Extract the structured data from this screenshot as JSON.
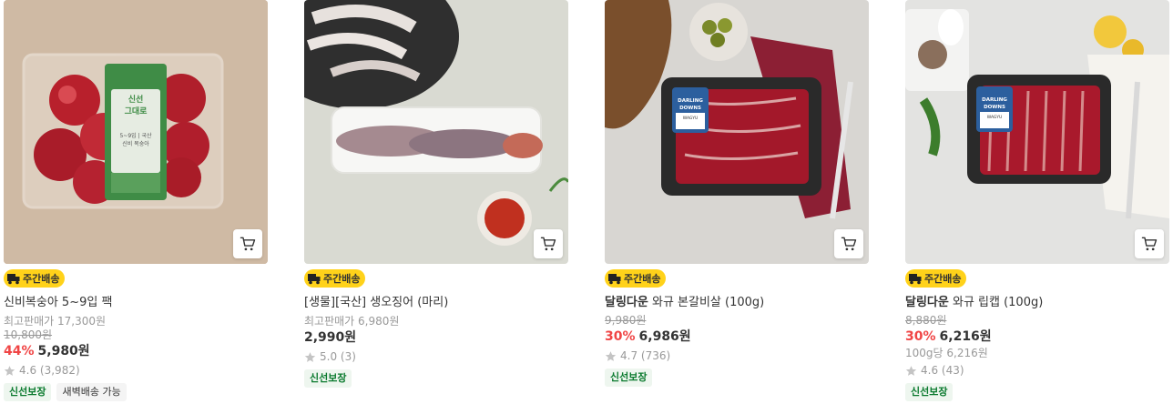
{
  "products": [
    {
      "weekly_badge": "주간배송",
      "brand": "",
      "name": "신비복숭아 5~9입 팩",
      "lowest_price": "최고판매가 17,300원",
      "original_price": "10,800원",
      "discount": "44%",
      "price": "5,980원",
      "unit_price": "",
      "rating": "4.6",
      "reviews": "(3,982)",
      "tags": [
        "신선보장",
        "새벽배송 가능"
      ]
    },
    {
      "weekly_badge": "주간배송",
      "brand": "",
      "name": "[생물][국산] 생오징어 (마리)",
      "lowest_price": "최고판매가 6,980원",
      "original_price": "",
      "discount": "",
      "price": "2,990원",
      "unit_price": "",
      "rating": "5.0",
      "reviews": "(3)",
      "tags": [
        "신선보장"
      ]
    },
    {
      "weekly_badge": "주간배송",
      "brand": "달링다운",
      "name": "와규 본갈비살 (100g)",
      "lowest_price": "",
      "original_price": "9,980원",
      "discount": "30%",
      "price": "6,986원",
      "unit_price": "",
      "rating": "4.7",
      "reviews": "(736)",
      "tags": [
        "신선보장"
      ]
    },
    {
      "weekly_badge": "주간배송",
      "brand": "달링다운",
      "name": "와규 립캡 (100g)",
      "lowest_price": "",
      "original_price": "8,880원",
      "discount": "30%",
      "price": "6,216원",
      "unit_price": "100g당 6,216원",
      "rating": "4.6",
      "reviews": "(43)",
      "tags": [
        "신선보장"
      ]
    }
  ],
  "package_labels": {
    "peach": [
      "신선",
      "그대로",
      "5~9입 | 국산",
      "신비 복숭아"
    ],
    "beef_brand": [
      "DARLING",
      "DOWNS",
      "WAGYU"
    ]
  },
  "colors": {
    "discount": "#f04545",
    "badge": "#ffd21a",
    "fresh_tag": "#0a7a2e"
  },
  "icons": {
    "cart": "cart-icon",
    "star": "star-icon",
    "truck": "truck-icon"
  }
}
